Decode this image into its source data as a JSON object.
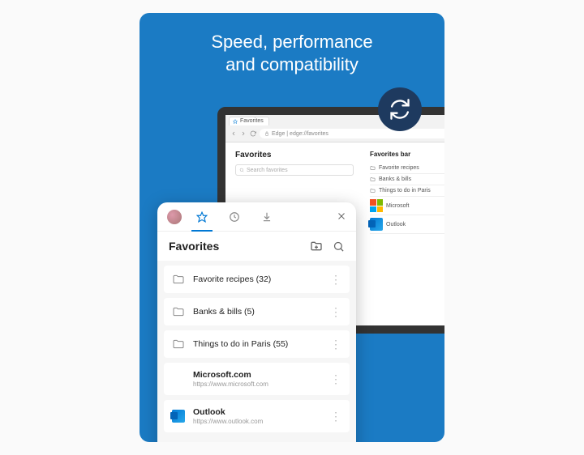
{
  "headline": {
    "line1": "Speed, performance",
    "line2": "and compatibility"
  },
  "laptop": {
    "tab_label": "Favorites",
    "address": "Edge | edge://favorites",
    "favorites_title": "Favorites",
    "search_placeholder": "Search favorites",
    "sidebar_title": "Favorites bar",
    "sidebar_items": [
      {
        "label": "Favorite recipes"
      },
      {
        "label": "Banks & bills"
      },
      {
        "label": "Things to do in Paris"
      },
      {
        "label": "Microsoft"
      },
      {
        "label": "Outlook"
      }
    ]
  },
  "phone": {
    "favorites_title": "Favorites",
    "items": [
      {
        "type": "folder",
        "label": "Favorite recipes (32)"
      },
      {
        "type": "folder",
        "label": "Banks & bills (5)"
      },
      {
        "type": "folder",
        "label": "Things to do in Paris (55)"
      },
      {
        "type": "site",
        "label": "Microsoft.com",
        "url": "https://www.microsoft.com",
        "icon": "ms"
      },
      {
        "type": "site",
        "label": "Outlook",
        "url": "https://www.outlook.com",
        "icon": "outlook"
      }
    ]
  },
  "colors": {
    "brand_blue": "#1b7bc4",
    "accent": "#0078d4",
    "badge_navy": "#1e3a5f"
  }
}
